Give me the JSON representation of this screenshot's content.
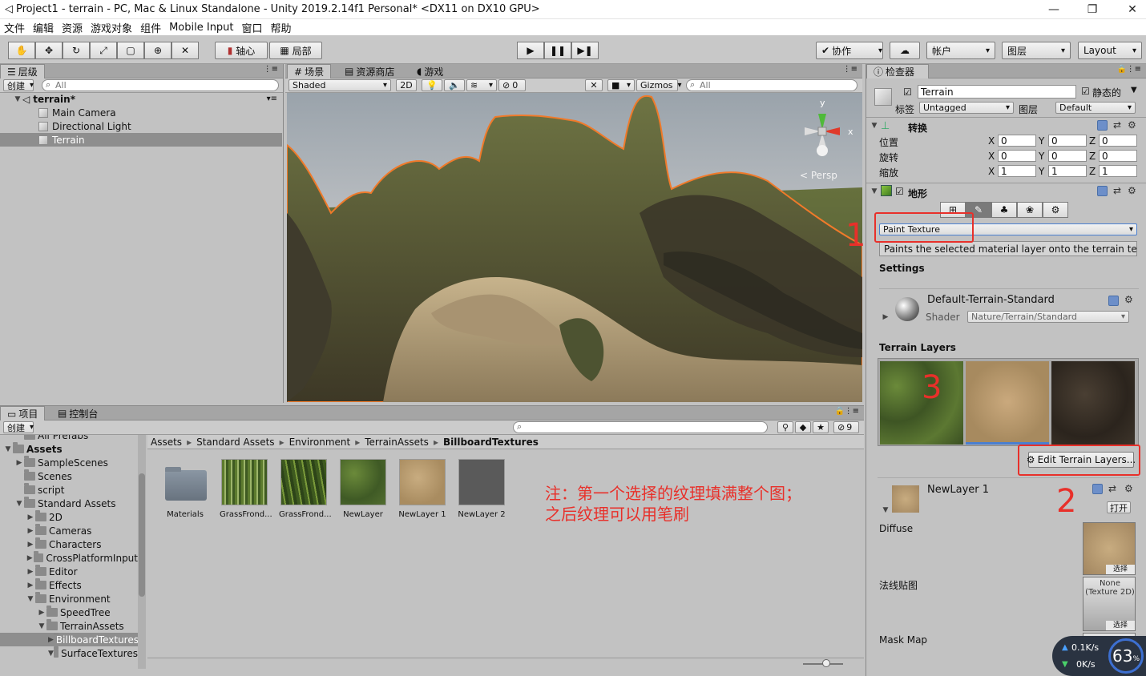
{
  "window": {
    "title": "Project1 - terrain - PC, Mac & Linux Standalone - Unity 2019.2.14f1 Personal* <DX11 on DX10 GPU>",
    "min": "—",
    "max": "❐",
    "close": "✕"
  },
  "menu": [
    "文件",
    "编辑",
    "资源",
    "游戏对象",
    "组件",
    "Mobile Input",
    "窗口",
    "帮助"
  ],
  "toolbar": {
    "pivot": "轴心",
    "local": "局部",
    "collab": "协作",
    "account": "帐户",
    "layers": "图层",
    "layout": "Layout"
  },
  "hierarchy": {
    "tab": "层级",
    "create": "创建",
    "search_placeholder": "All",
    "scene": "terrain*",
    "items": [
      "Main Camera",
      "Directional Light",
      "Terrain"
    ]
  },
  "scene": {
    "tabs": [
      "场景",
      "资源商店",
      "游戏"
    ],
    "shading": "Shaded",
    "mode2d": "2D",
    "fx_count": "0",
    "gizmos": "Gizmos",
    "search_placeholder": "All",
    "persp": "< Persp",
    "gizmo_y": "y",
    "gizmo_x": "x"
  },
  "project": {
    "tabs": [
      "项目",
      "控制台"
    ],
    "create": "创建",
    "hidden_count": "9",
    "breadcrumb": [
      "Assets",
      "Standard Assets",
      "Environment",
      "TerrainAssets",
      "BillboardTextures"
    ],
    "tree": [
      {
        "label": "All Prefabs",
        "indent": 1,
        "arrow": ""
      },
      {
        "label": "Assets",
        "indent": 0,
        "arrow": "▼",
        "bold": true
      },
      {
        "label": "SampleScenes",
        "indent": 1,
        "arrow": "▶"
      },
      {
        "label": "Scenes",
        "indent": 1,
        "arrow": ""
      },
      {
        "label": "script",
        "indent": 1,
        "arrow": ""
      },
      {
        "label": "Standard Assets",
        "indent": 1,
        "arrow": "▼"
      },
      {
        "label": "2D",
        "indent": 2,
        "arrow": "▶"
      },
      {
        "label": "Cameras",
        "indent": 2,
        "arrow": "▶"
      },
      {
        "label": "Characters",
        "indent": 2,
        "arrow": "▶"
      },
      {
        "label": "CrossPlatformInput",
        "indent": 2,
        "arrow": "▶"
      },
      {
        "label": "Editor",
        "indent": 2,
        "arrow": "▶"
      },
      {
        "label": "Effects",
        "indent": 2,
        "arrow": "▶"
      },
      {
        "label": "Environment",
        "indent": 2,
        "arrow": "▼"
      },
      {
        "label": "SpeedTree",
        "indent": 3,
        "arrow": "▶"
      },
      {
        "label": "TerrainAssets",
        "indent": 3,
        "arrow": "▼"
      },
      {
        "label": "BillboardTextures",
        "indent": 4,
        "arrow": "▶",
        "selected": true
      },
      {
        "label": "SurfaceTextures",
        "indent": 4,
        "arrow": "▼"
      }
    ],
    "assets": [
      "Materials",
      "GrassFrond...",
      "GrassFrond...",
      "NewLayer",
      "NewLayer 1",
      "NewLayer 2"
    ],
    "note_line1": "注：第一个选择的纹理填满整个图；",
    "note_line2": "之后纹理可以用笔刷"
  },
  "inspector": {
    "tab": "检查器",
    "object_name": "Terrain",
    "static": "静态的",
    "tag_label": "标签",
    "tag_value": "Untagged",
    "layer_label": "图层",
    "layer_value": "Default",
    "transform": {
      "title": "转换",
      "rows": [
        {
          "label": "位置",
          "x": "0",
          "y": "0",
          "z": "0"
        },
        {
          "label": "旋转",
          "x": "0",
          "y": "0",
          "z": "0"
        },
        {
          "label": "缩放",
          "x": "1",
          "y": "1",
          "z": "1"
        }
      ],
      "ax": "X",
      "ay": "Y",
      "az": "Z"
    },
    "terrain": {
      "title": "地形",
      "mode": "Paint Texture",
      "description": "Paints the selected material layer onto the terrain textu",
      "settings": "Settings",
      "material_name": "Default-Terrain-Standard",
      "shader_label": "Shader",
      "shader_value": "Nature/Terrain/Standard",
      "layers_title": "Terrain Layers",
      "edit_layers": "Edit Terrain Layers...",
      "layer_name": "NewLayer 1",
      "open": "打开",
      "diffuse": "Diffuse",
      "normal": "法线贴图",
      "mask": "Mask Map",
      "select": "选择",
      "none_texture": "None (Texture 2D)"
    }
  },
  "annotations": {
    "n1": "1",
    "n2": "2",
    "n3": "3"
  },
  "net": {
    "up": "0.1K/s",
    "down": "0K/s",
    "percent": "63",
    "percent_unit": "%"
  }
}
